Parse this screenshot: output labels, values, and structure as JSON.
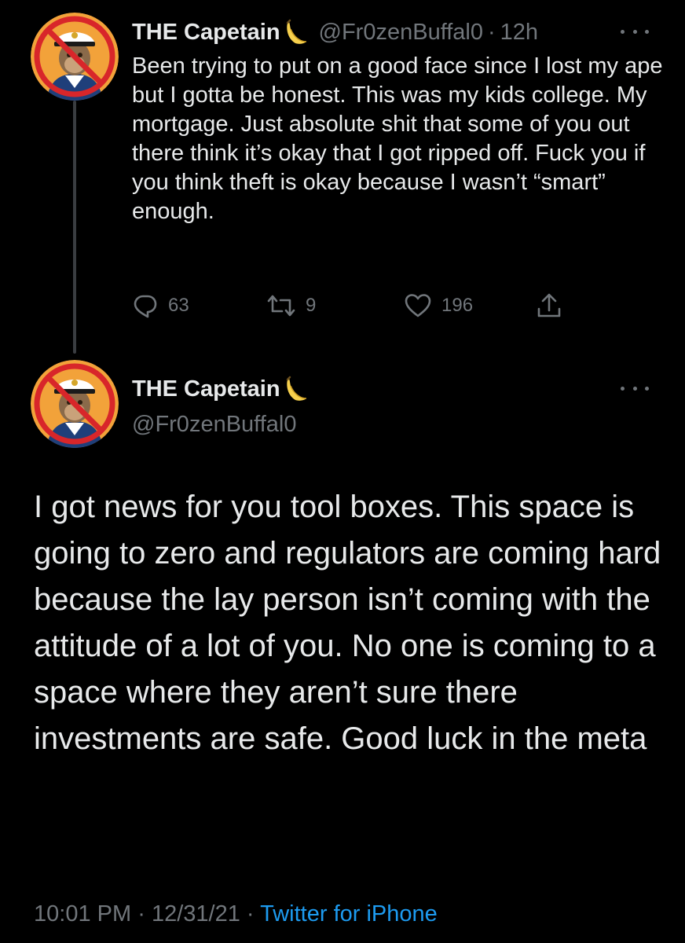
{
  "tweet1": {
    "display_name": "THE Capetain",
    "handle": "@Fr0zenBuffal0",
    "separator": "·",
    "time": "12h",
    "text": "Been trying to put on a good face since I lost my ape but I gotta be honest. This was my kids college. My mortgage. Just absolute shit that some of you out there think it’s okay that I got ripped off. Fuck you if you think theft is okay because I wasn’t “smart” enough.",
    "actions": {
      "reply_count": "63",
      "retweet_count": "9",
      "like_count": "196"
    }
  },
  "tweet2": {
    "display_name": "THE Capetain",
    "handle": "@Fr0zenBuffal0",
    "text": "I got news for you tool boxes. This space is going to zero and regulators are coming hard because the lay person isn’t coming with the attitude of a lot of you. No one is coming to a space where they aren’t sure there investments are safe. Good luck in the meta",
    "time": "10:01 PM",
    "date": "12/31/21",
    "separator": "·",
    "source": "Twitter for iPhone"
  },
  "icons": {
    "avatar": "avatar-ape-icon",
    "name_badge": "banana-icon",
    "more": "more-icon",
    "reply": "reply-icon",
    "retweet": "retweet-icon",
    "like": "like-icon",
    "share": "share-icon"
  },
  "colors": {
    "background": "#000000",
    "text_primary": "#e7e9ea",
    "text_secondary": "#71767b",
    "link": "#1d9bf0",
    "avatar_bg": "#f2a23a",
    "avatar_strike": "#d8262a"
  }
}
